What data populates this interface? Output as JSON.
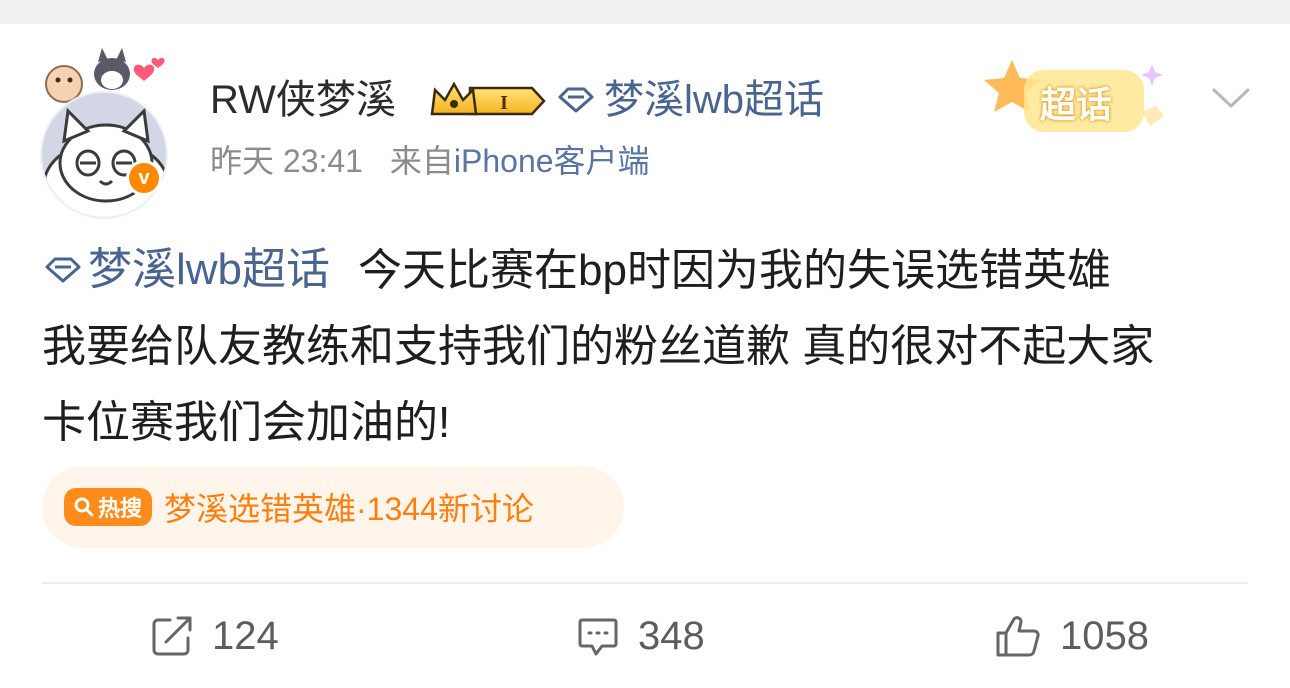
{
  "post": {
    "author": "RW侠梦溪",
    "header_topic": "梦溪lwb超话",
    "timestamp": "昨天 23:41",
    "source_prefix": "来自",
    "source_device": "iPhone客户端",
    "badge_level": "I",
    "sticker_label": "超话",
    "content": {
      "topic_tag": "梦溪lwb超话",
      "line1": "今天比赛在bp时因为我的失误选错英雄",
      "line2": "我要给队友教练和支持我们的粉丝道歉 真的很对不起大家",
      "line3": "卡位赛我们会加油的!"
    },
    "hot_search": {
      "tag_label": "热搜",
      "text": "梦溪选错英雄·1344新讨论"
    },
    "actions": {
      "share_count": "124",
      "comment_count": "348",
      "like_count": "1058"
    }
  },
  "colors": {
    "link": "#48648f",
    "hot_orange": "#ff8c1a",
    "verified_orange": "#ff8a00",
    "meta_gray": "#8b8b8b"
  },
  "icons": {
    "verified": "v-badge-icon",
    "crown": "crown-icon",
    "topic": "diamond-icon",
    "expand": "chevron-down-icon",
    "share": "share-icon",
    "comment": "comment-icon",
    "like": "thumbs-up-icon",
    "hot_search": "search-icon"
  }
}
